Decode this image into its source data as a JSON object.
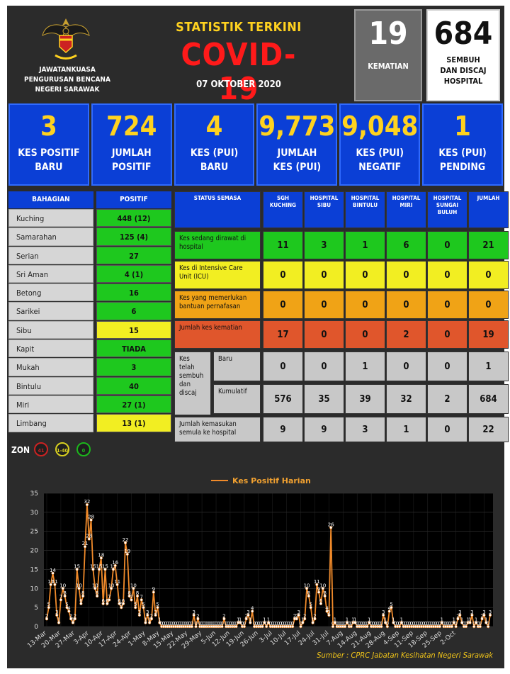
{
  "header": {
    "agency": [
      "JAWATANKUASA",
      "PENGURUSAN BENCANA",
      "NEGERI SARAWAK"
    ],
    "title": "STATISTIK TERKINI",
    "covid": "COVID-19",
    "date": "07 OKTOBER 2020",
    "deaths_value": "19",
    "deaths_label": "KEMATIAN",
    "recovered_value": "684",
    "recovered_label": [
      "SEMBUH",
      "DAN DISCAJ",
      "HOSPITAL"
    ]
  },
  "stats": [
    {
      "value": "3",
      "label": [
        "KES POSITIF",
        "BARU"
      ]
    },
    {
      "value": "724",
      "label": [
        "JUMLAH",
        "POSITIF"
      ]
    },
    {
      "value": "4",
      "label": [
        "KES (PUI)",
        "BARU"
      ]
    },
    {
      "value": "9,773",
      "label": [
        "JUMLAH",
        "KES (PUI)"
      ]
    },
    {
      "value": "9,048",
      "label": [
        "KES (PUI)",
        "NEGATIF"
      ]
    },
    {
      "value": "1",
      "label": [
        "KES (PUI)",
        "PENDING"
      ]
    }
  ],
  "regions": {
    "header_name": "BAHAGIAN",
    "header_value": "POSITIF",
    "rows": [
      {
        "name": "Kuching",
        "value": "448 (12)",
        "color": "green"
      },
      {
        "name": "Samarahan",
        "value": "125 (4)",
        "color": "green"
      },
      {
        "name": "Serian",
        "value": "27",
        "color": "green"
      },
      {
        "name": "Sri Aman",
        "value": "4 (1)",
        "color": "green"
      },
      {
        "name": "Betong",
        "value": "16",
        "color": "green"
      },
      {
        "name": "Sarikei",
        "value": "6",
        "color": "green"
      },
      {
        "name": "Sibu",
        "value": "15",
        "color": "yellow"
      },
      {
        "name": "Kapit",
        "value": "TIADA",
        "color": "green"
      },
      {
        "name": "Mukah",
        "value": "3",
        "color": "green"
      },
      {
        "name": "Bintulu",
        "value": "40",
        "color": "green"
      },
      {
        "name": "Miri",
        "value": "27 (1)",
        "color": "green"
      },
      {
        "name": "Limbang",
        "value": "13 (1)",
        "color": "yellow"
      }
    ]
  },
  "hospitals": {
    "status_header": "STATUS SEMASA",
    "columns": [
      "SGH KUCHING",
      "HOSPITAL SIBU",
      "HOSPITAL BINTULU",
      "HOSPITAL MIRI",
      "HOSPITAL SUNGAI BULUH",
      "JUMLAH"
    ],
    "rows": [
      {
        "label": "Kes sedang dirawat di hospital",
        "values": [
          "11",
          "3",
          "1",
          "6",
          "0",
          "21"
        ]
      },
      {
        "label": "Kes di Intensive Care Unit (ICU)",
        "values": [
          "0",
          "0",
          "0",
          "0",
          "0",
          "0"
        ]
      },
      {
        "label": "Kes yang memerlukan bantuan pernafasan",
        "values": [
          "0",
          "0",
          "0",
          "0",
          "0",
          "0"
        ]
      },
      {
        "label": "Jumlah kes kematian",
        "values": [
          "17",
          "0",
          "0",
          "2",
          "0",
          "19"
        ]
      }
    ],
    "recovered_group_label": "Kes telah sembuh dan discaj",
    "recovered_rows": [
      {
        "label": "Baru",
        "values": [
          "0",
          "0",
          "1",
          "0",
          "0",
          "1"
        ]
      },
      {
        "label": "Kumulatif",
        "values": [
          "576",
          "35",
          "39",
          "32",
          "2",
          "684"
        ]
      }
    ],
    "readmit_row": {
      "label": "Jumlah kemasukan semula ke hospital",
      "values": [
        "9",
        "9",
        "3",
        "1",
        "0",
        "22"
      ]
    }
  },
  "zone": {
    "label": "ZON",
    "badges": [
      {
        "text": "41",
        "color": "#cc2222"
      },
      {
        "text": "1-40",
        "color": "#d8d020"
      },
      {
        "text": "0",
        "color": "#1cb81c"
      }
    ]
  },
  "source": "Sumber : CPRC Jabatan Kesihatan Negeri Sarawak",
  "chart_data": {
    "type": "line",
    "title": "",
    "legend": "Kes Positif Harian",
    "legend_position": "top",
    "series_color": "#f08a2a",
    "ylim": [
      0,
      35
    ],
    "yticks": [
      0,
      5,
      10,
      15,
      20,
      25,
      30,
      35
    ],
    "xticks": [
      "13-Mar",
      "20-Mar",
      "27-Mar",
      "3-Apr",
      "10-Apr",
      "17-Apr",
      "24-Apr",
      "1-May",
      "8-May",
      "15-May",
      "22-May",
      "29-May",
      "5-Jun",
      "12-Jun",
      "19-Jun",
      "26-Jun",
      "3-Jul",
      "10-Jul",
      "17-Jul",
      "24-Jul",
      "31-Jul",
      "7-Aug",
      "14-Aug",
      "21-Aug",
      "28-Aug",
      "4-Sep",
      "11-Sep",
      "18-Sep",
      "25-Sep",
      "2-Oct"
    ],
    "start_label": "13-Mar",
    "values": [
      2,
      5,
      11,
      14,
      11,
      3,
      1,
      7,
      10,
      8,
      5,
      4,
      2,
      1,
      2,
      15,
      10,
      6,
      8,
      21,
      32,
      23,
      28,
      15,
      10,
      8,
      15,
      18,
      6,
      15,
      6,
      7,
      10,
      15,
      16,
      11,
      6,
      5,
      6,
      22,
      19,
      8,
      7,
      10,
      5,
      8,
      3,
      7,
      5,
      1,
      3,
      1,
      2,
      9,
      3,
      5,
      1,
      0,
      0,
      0,
      0,
      0,
      0,
      0,
      0,
      0,
      0,
      0,
      0,
      0,
      0,
      0,
      0,
      3,
      0,
      2,
      0,
      0,
      0,
      0,
      0,
      0,
      0,
      0,
      0,
      0,
      0,
      0,
      2,
      0,
      0,
      0,
      0,
      0,
      0,
      1,
      1,
      0,
      0,
      2,
      3,
      1,
      4,
      0,
      0,
      0,
      0,
      0,
      1,
      0,
      1,
      0,
      0,
      0,
      0,
      0,
      0,
      0,
      0,
      0,
      0,
      0,
      0,
      2,
      2,
      3,
      0,
      1,
      2,
      10,
      8,
      5,
      1,
      2,
      11,
      9,
      6,
      10,
      8,
      4,
      3,
      26,
      0,
      1,
      0,
      0,
      0,
      0,
      0,
      1,
      0,
      0,
      1,
      1,
      0,
      0,
      0,
      0,
      0,
      0,
      1,
      0,
      0,
      0,
      0,
      0,
      0,
      3,
      1,
      0,
      4,
      5,
      1,
      0,
      0,
      0,
      1,
      0,
      0,
      0,
      0,
      0,
      0,
      0,
      0,
      0,
      0,
      0,
      0,
      0,
      0,
      0,
      0,
      0,
      0,
      0,
      1,
      0,
      0,
      0,
      0,
      0,
      1,
      0,
      2,
      3,
      1,
      0,
      0,
      1,
      1,
      3,
      0,
      1,
      0,
      0,
      2,
      3,
      1,
      0,
      3
    ]
  }
}
